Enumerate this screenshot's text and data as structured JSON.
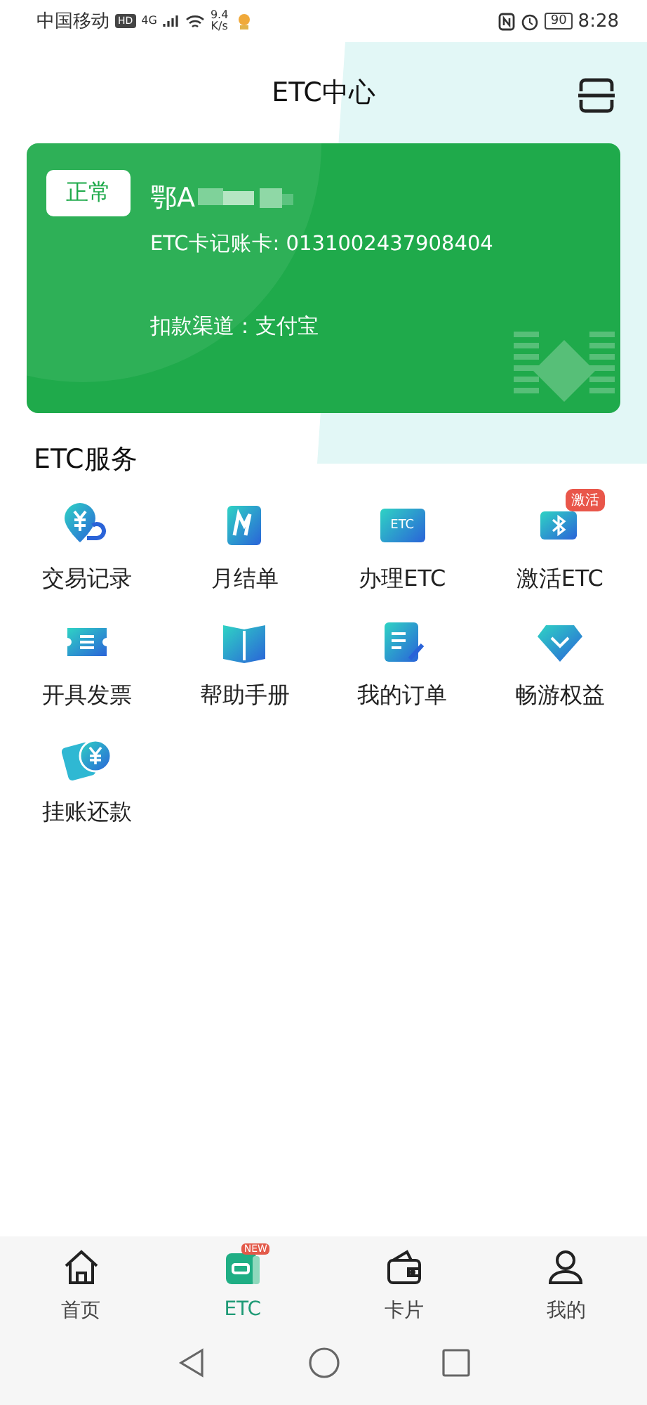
{
  "status_bar": {
    "carrier": "中国移动",
    "hd": "HD",
    "network": "4G",
    "speed_value": "9.4",
    "speed_unit": "K/s",
    "battery": "90",
    "time": "8:28"
  },
  "header": {
    "title": "ETC中心"
  },
  "card": {
    "status": "正常",
    "plate": "鄂A",
    "card_number": "ETC卡记账卡: 0131002437908404",
    "payment": "扣款渠道：支付宝"
  },
  "services": {
    "title": "ETC服务",
    "items": [
      {
        "label": "交易记录",
        "kind": "coin"
      },
      {
        "label": "月结单",
        "kind": "logo"
      },
      {
        "label": "办理ETC",
        "kind": "etc",
        "icon_text": "ETC"
      },
      {
        "label": "激活ETC",
        "kind": "bluetooth",
        "badge": "激活"
      },
      {
        "label": "开具发票",
        "kind": "ticket"
      },
      {
        "label": "帮助手册",
        "kind": "book"
      },
      {
        "label": "我的订单",
        "kind": "order"
      },
      {
        "label": "畅游权益",
        "kind": "diamond"
      },
      {
        "label": "挂账还款",
        "kind": "repay"
      }
    ]
  },
  "tabs": [
    {
      "label": "首页",
      "kind": "home",
      "selected": false
    },
    {
      "label": "ETC",
      "kind": "etc",
      "selected": true,
      "badge": "NEW"
    },
    {
      "label": "卡片",
      "kind": "wallet",
      "selected": false
    },
    {
      "label": "我的",
      "kind": "person",
      "selected": false
    }
  ]
}
